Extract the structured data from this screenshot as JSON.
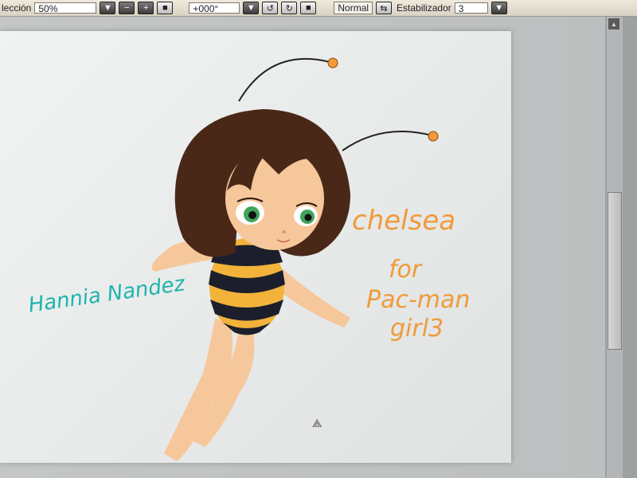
{
  "toolbar": {
    "selection_label": "lección",
    "zoom_value": "50%",
    "rotation_value": "+000°",
    "blend_mode": "Normal",
    "stabilizer_label": "Estabilizador",
    "stabilizer_value": "3"
  },
  "artwork": {
    "signature": "Hannia Nandez",
    "character_name": "chelsea",
    "for_text": "for",
    "recipient_line1": "Pac-man",
    "recipient_line2": "girl3"
  },
  "colors": {
    "signature": "#1fb3ae",
    "dedication": "#f09a3a",
    "hair": "#4a2818",
    "skin": "#f6c79a",
    "stripe_yellow": "#f3b23a",
    "stripe_dark": "#1c1f2b"
  },
  "icons": [
    "dropdown-icon",
    "zoom-out-icon",
    "zoom-in-icon",
    "zoom-reset-icon",
    "rotate-left-icon",
    "rotate-right-icon",
    "rotate-reset-icon",
    "swap-icon",
    "scroll-up-icon",
    "cursor-icon"
  ]
}
